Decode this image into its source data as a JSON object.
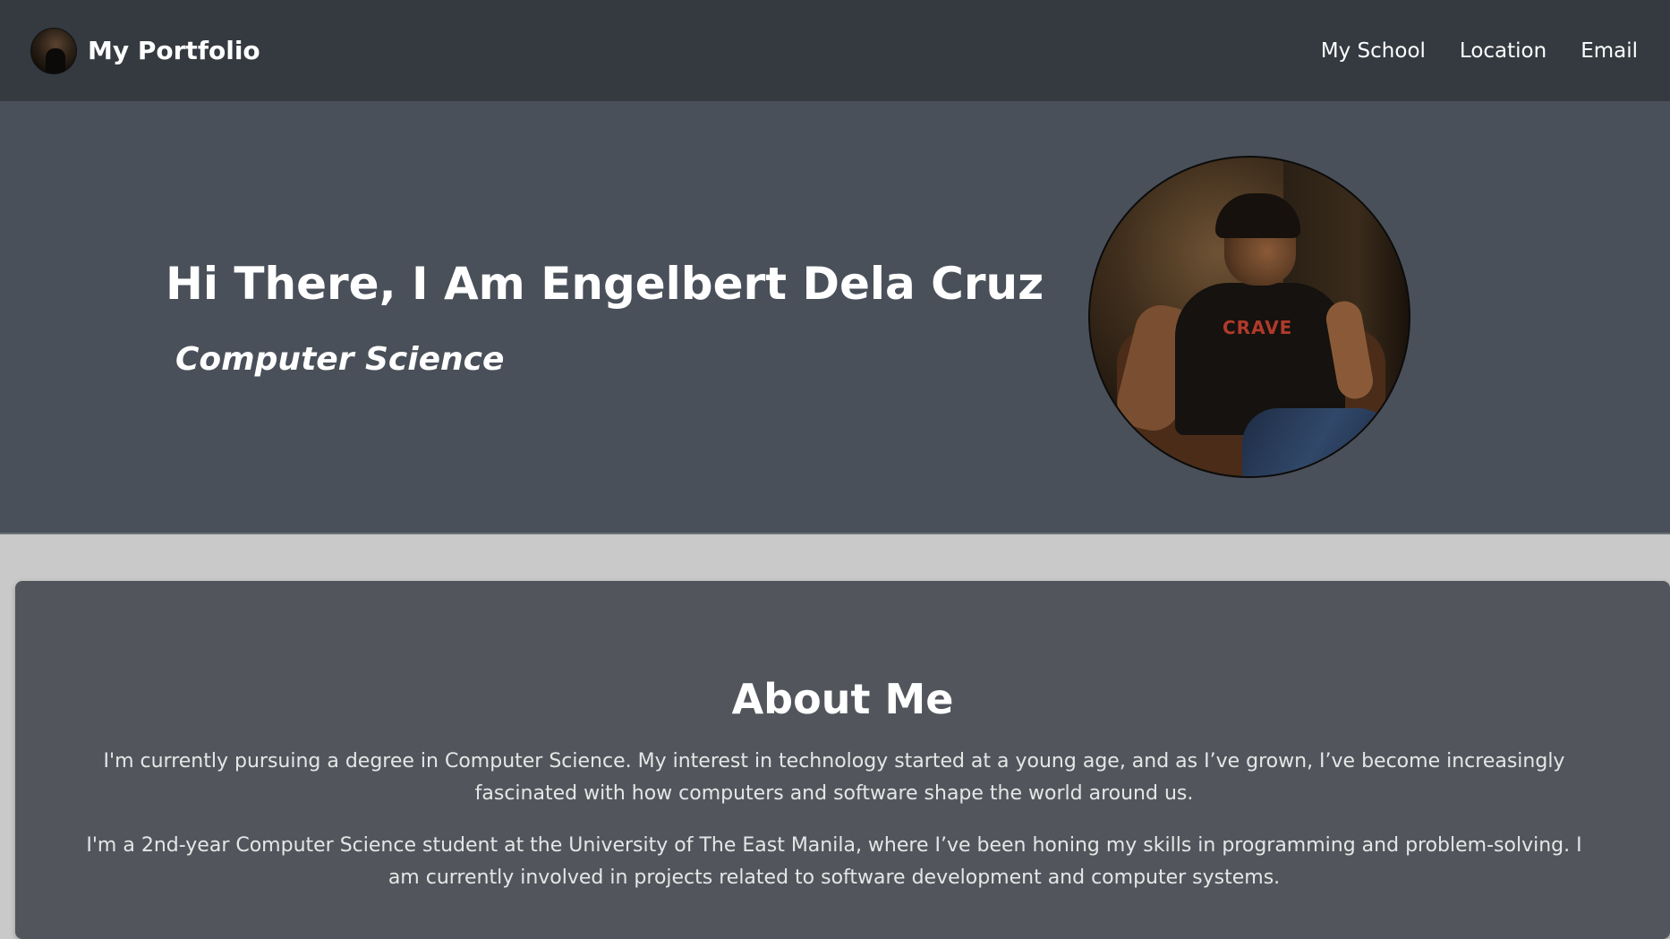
{
  "navbar": {
    "brand_title": "My Portfolio",
    "links": [
      {
        "label": "My School"
      },
      {
        "label": "Location"
      },
      {
        "label": "Email"
      }
    ]
  },
  "hero": {
    "heading": "Hi There, I Am Engelbert Dela Cruz",
    "subheading": "Computer Science",
    "photo_shirt_text": "CRAVE"
  },
  "about": {
    "title": "About Me",
    "paragraphs": [
      "I'm currently pursuing a degree in Computer Science. My interest in technology started at a young age, and as I’ve grown, I’ve become increasingly fascinated with how computers and software shape the world around us.",
      "I'm a 2nd-year Computer Science student at the University of The East Manila, where I’ve been honing my skills in programming and problem-solving. I am currently involved in projects related to software development and computer systems."
    ]
  },
  "colors": {
    "navbar_bg": "#343a40",
    "hero_bg": "#4a5059",
    "card_bg": "#52565c",
    "page_bg": "#c9c9c9",
    "text": "#ffffff"
  }
}
